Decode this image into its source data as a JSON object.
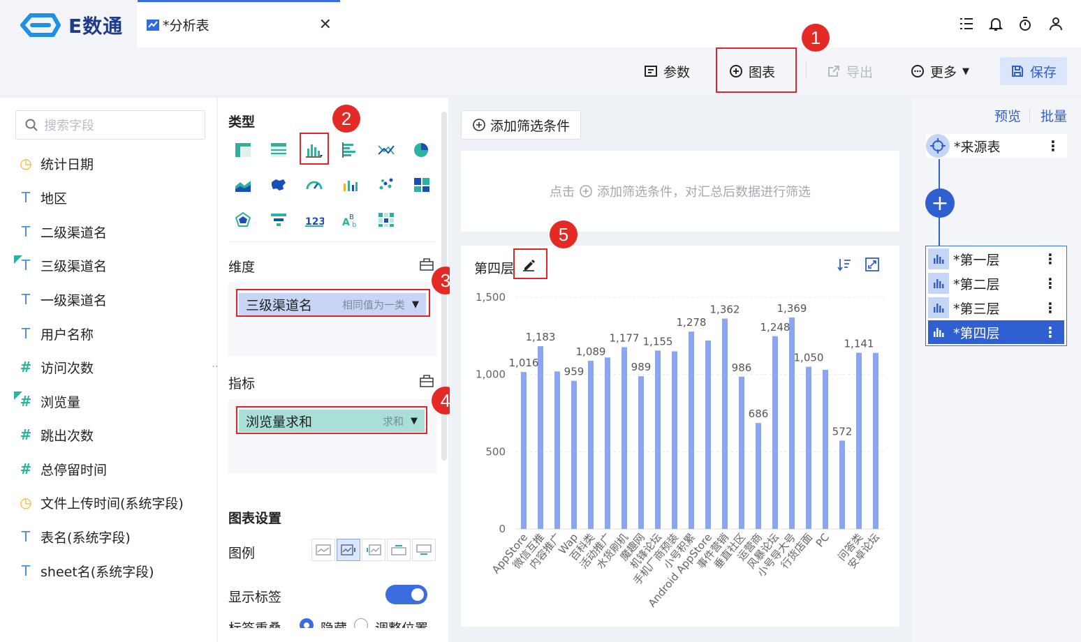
{
  "app": {
    "logo_text": "E数通"
  },
  "tab": {
    "label": "*分析表"
  },
  "toolbar": {
    "params_label": "参数",
    "chart_label": "图表",
    "export_label": "导出",
    "more_label": "更多",
    "save_label": "保存"
  },
  "search": {
    "placeholder": "搜索字段"
  },
  "fields": [
    {
      "name": "统计日期",
      "type": "date"
    },
    {
      "name": "地区",
      "type": "text"
    },
    {
      "name": "二级渠道名",
      "type": "text"
    },
    {
      "name": "三级渠道名",
      "type": "text",
      "used": true
    },
    {
      "name": "一级渠道名",
      "type": "text"
    },
    {
      "name": "用户名称",
      "type": "text"
    },
    {
      "name": "访问次数",
      "type": "number"
    },
    {
      "name": "浏览量",
      "type": "number",
      "used": true
    },
    {
      "name": "跳出次数",
      "type": "number"
    },
    {
      "name": "总停留时间",
      "type": "number"
    },
    {
      "name": "文件上传时间(系统字段)",
      "type": "date"
    },
    {
      "name": "表名(系统字段)",
      "type": "text"
    },
    {
      "name": "sheet名(系统字段)",
      "type": "text"
    }
  ],
  "config": {
    "type_title": "类型",
    "dimension_label": "维度",
    "dimension_pill": {
      "name": "三级渠道名",
      "sub": "相同值为一类"
    },
    "metric_label": "指标",
    "metric_pill": {
      "name": "浏览量求和",
      "sub": "求和"
    },
    "chart_settings_title": "图表设置",
    "legend_label": "图例",
    "show_labels_label": "显示标签",
    "overlap_label": "标签重叠",
    "overlap_option1": "隐藏",
    "overlap_option2": "调整位置"
  },
  "filter": {
    "add_button": "添加筛选条件",
    "hint_prefix": "点击",
    "hint_suffix": "添加筛选条件，对汇总后数据进行筛选"
  },
  "chart_card": {
    "title": "第四层"
  },
  "right_panel": {
    "preview_label": "预览",
    "batch_label": "批量",
    "source_label": "*来源表",
    "layers": [
      "*第一层",
      "*第二层",
      "*第三层",
      "*第四层"
    ],
    "active_layer": 3
  },
  "annotations": [
    "1",
    "2",
    "3",
    "4",
    "5"
  ],
  "colors": {
    "accent": "#3b6ce0",
    "bar": "#8aa6f2",
    "annotation_red": "#e32a25"
  },
  "chart_data": {
    "type": "bar",
    "categories": [
      "AppStore",
      "微信互推",
      "内容推广",
      "Wap",
      "百科类",
      "活动推广",
      "水货刷机",
      "魔趣网",
      "机锋论坛",
      "手机厂商预装",
      "小号积累",
      "Android AppStore",
      "事件营销",
      "垂直社区",
      "运营商",
      "风暴论坛",
      "小号导大号",
      "行货店面",
      "PC",
      "问答类",
      "安卓论坛"
    ],
    "values": [
      1016,
      1183,
      1020,
      959,
      1089,
      1110,
      1177,
      989,
      1155,
      1150,
      1278,
      1220,
      1362,
      986,
      686,
      1248,
      1369,
      1050,
      1030,
      572,
      1141,
      1140
    ],
    "labels": [
      {
        "text": "1,016",
        "index": 0
      },
      {
        "text": "1,183",
        "index": 1
      },
      {
        "text": "959",
        "index": 3
      },
      {
        "text": "1,089",
        "index": 4
      },
      {
        "text": "1,177",
        "index": 6
      },
      {
        "text": "989",
        "index": 7
      },
      {
        "text": "1,155",
        "index": 8
      },
      {
        "text": "1,278",
        "index": 10
      },
      {
        "text": "1,362",
        "index": 12
      },
      {
        "text": "986",
        "index": 13
      },
      {
        "text": "686",
        "index": 14
      },
      {
        "text": "1,248",
        "index": 15
      },
      {
        "text": "1,369",
        "index": 16
      },
      {
        "text": "1,050",
        "index": 17
      },
      {
        "text": "572",
        "index": 19
      },
      {
        "text": "1,141",
        "index": 20
      }
    ],
    "category_index": [
      0,
      1,
      2,
      3,
      4,
      5,
      6,
      7,
      8,
      9,
      10,
      11,
      12,
      13,
      14,
      15,
      16,
      17,
      18,
      19,
      20
    ],
    "yticks": [
      "0",
      "500",
      "1,000",
      "1,500"
    ],
    "ylim": [
      0,
      1500
    ],
    "grid": true
  }
}
